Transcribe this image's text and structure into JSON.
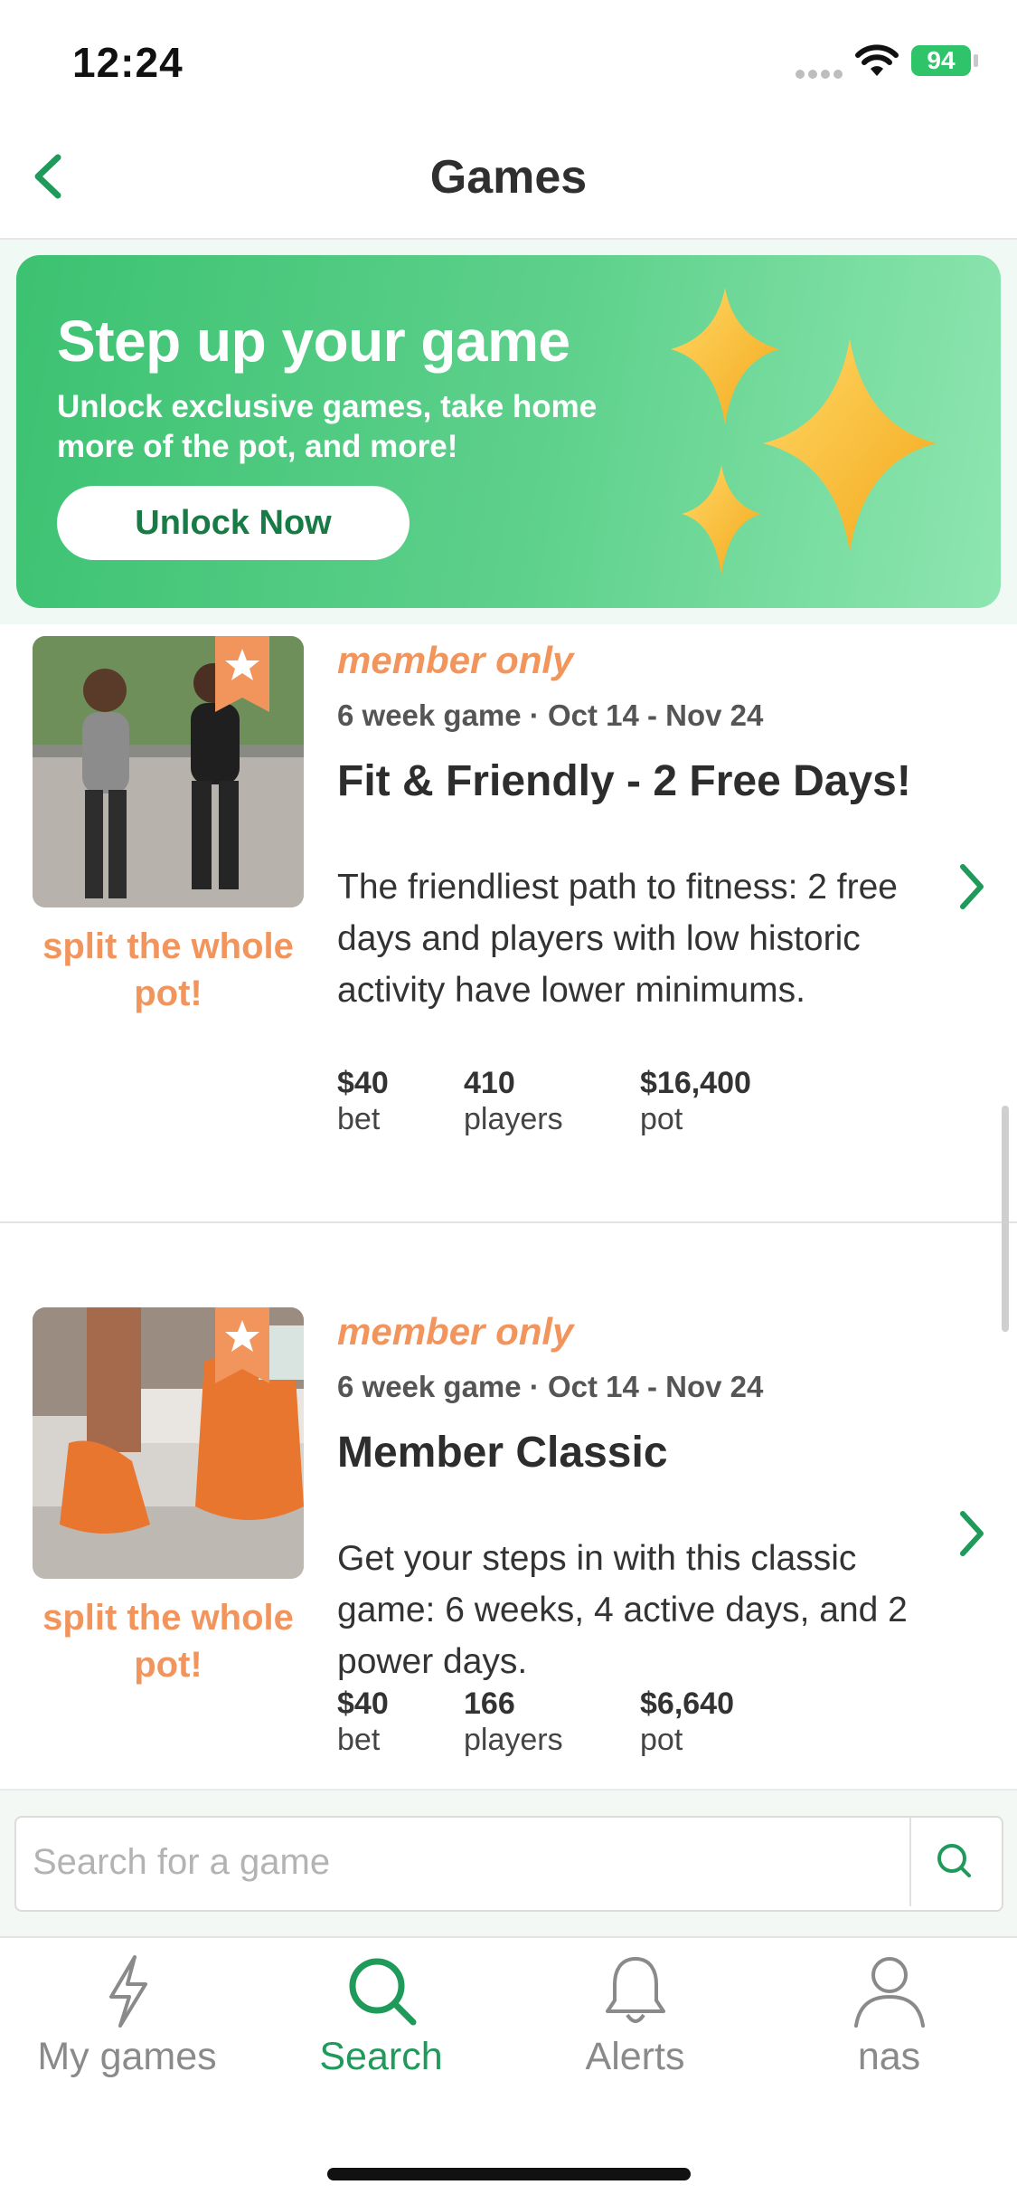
{
  "status_bar": {
    "time": "12:24",
    "battery": "94"
  },
  "header": {
    "title": "Games",
    "back_icon": "chevron-left-icon"
  },
  "promo": {
    "title": "Step up your game",
    "subtitle": "Unlock exclusive games, take home more of the pot, and more!",
    "button_label": "Unlock Now"
  },
  "games": [
    {
      "badge": "member only",
      "meta": "6 week game · Oct 14 - Nov 24",
      "title": "Fit & Friendly - 2 Free Days!",
      "description": "The friendliest path to fitness: 2 free days and players with low historic activity have lower minimums.",
      "split_label": "split the whole pot!",
      "bet": "$40",
      "bet_label": "bet",
      "players": "410",
      "players_label": "players",
      "pot": "$16,400",
      "pot_label": "pot"
    },
    {
      "badge": "member only",
      "meta": "6 week game · Oct 14 - Nov 24",
      "title": "Member Classic",
      "description": "Get your steps in with this classic game: 6 weeks, 4 active days, and 2 power days.",
      "split_label": "split the whole pot!",
      "bet": "$40",
      "bet_label": "bet",
      "players": "166",
      "players_label": "players",
      "pot": "$6,640",
      "pot_label": "pot"
    }
  ],
  "search": {
    "placeholder": "Search for a game",
    "value": ""
  },
  "tabs": [
    {
      "label": "My games",
      "icon": "lightning-icon",
      "active": false
    },
    {
      "label": "Search",
      "icon": "search-icon",
      "active": true
    },
    {
      "label": "Alerts",
      "icon": "bell-icon",
      "active": false
    },
    {
      "label": "nas",
      "icon": "profile-icon",
      "active": false
    }
  ],
  "colors": {
    "accent": "#1f9a5b",
    "member": "#f2955c",
    "banner": "#4cc87c"
  }
}
